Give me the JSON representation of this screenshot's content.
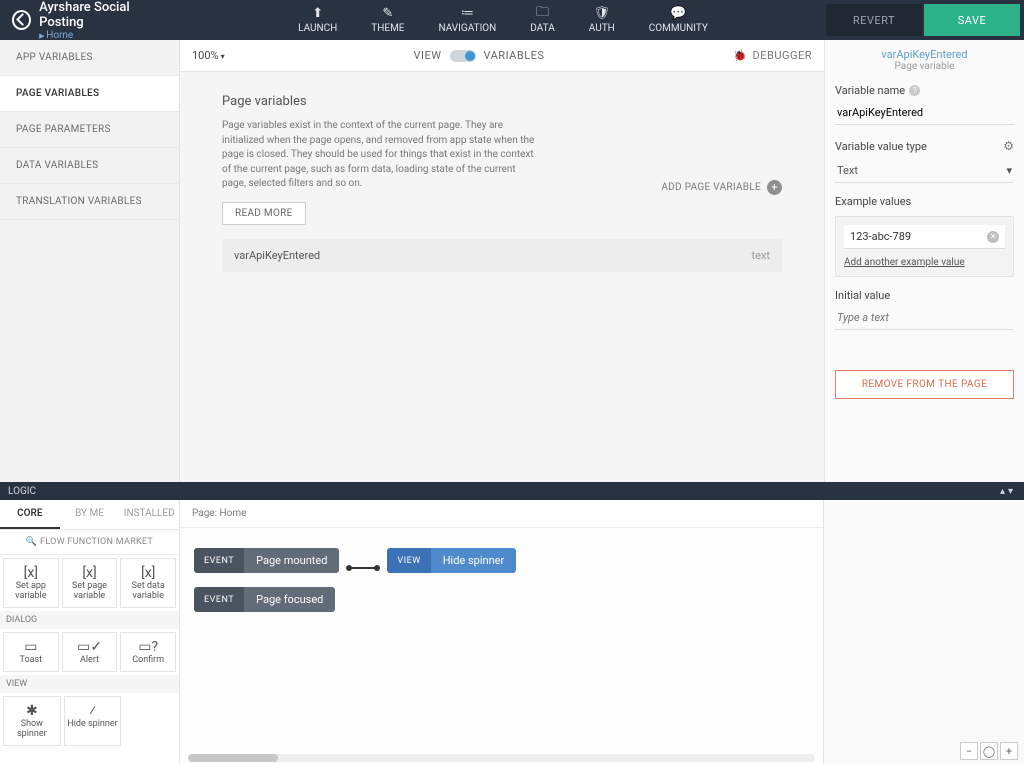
{
  "header": {
    "app_title": "Ayrshare Social Posting",
    "breadcrumb": "Home",
    "nav": [
      {
        "label": "LAUNCH",
        "icon": "⬆"
      },
      {
        "label": "THEME",
        "icon": "✎"
      },
      {
        "label": "NAVIGATION",
        "icon": "≔"
      },
      {
        "label": "DATA",
        "icon": "🗀"
      },
      {
        "label": "AUTH",
        "icon": "🛡"
      },
      {
        "label": "COMMUNITY",
        "icon": "💬"
      }
    ],
    "revert": "REVERT",
    "save": "SAVE"
  },
  "canvas_toolbar": {
    "zoom": "100%",
    "view": "VIEW",
    "variables": "VARIABLES",
    "debugger": "DEBUGGER"
  },
  "leftnav": [
    "APP VARIABLES",
    "PAGE VARIABLES",
    "PAGE PARAMETERS",
    "DATA VARIABLES",
    "TRANSLATION VARIABLES"
  ],
  "leftnav_active": 1,
  "page_variables": {
    "title": "Page variables",
    "desc": "Page variables exist in the context of the current page. They are initialized when the page opens, and removed from app state when the page is closed. They should be used for things that exist in the context of the current page, such as form data, loading state of the current page, selected filters and so on.",
    "read_more": "READ MORE",
    "add": "ADD PAGE VARIABLE",
    "rows": [
      {
        "name": "varApiKeyEntered",
        "type": "text"
      }
    ]
  },
  "right_panel": {
    "crumb": "varApiKeyEntered",
    "sub": "Page variable",
    "name_label": "Variable name",
    "name_value": "varApiKeyEntered",
    "type_label": "Variable value type",
    "type_value": "Text",
    "examples_label": "Example values",
    "examples": [
      "123-abc-789"
    ],
    "add_example": "Add another example value",
    "initial_label": "Initial value",
    "initial_placeholder": "Type a text",
    "remove": "REMOVE FROM THE PAGE"
  },
  "logic": {
    "bar": "LOGIC",
    "tabs": [
      "CORE",
      "BY ME",
      "INSTALLED"
    ],
    "tabs_active": 0,
    "ffm": "FLOW FUNCTION MARKET",
    "groups": [
      {
        "cat": "",
        "tiles": [
          {
            "label": "Set app variable",
            "icon": "[x]"
          },
          {
            "label": "Set page variable",
            "icon": "[x]"
          },
          {
            "label": "Set data variable",
            "icon": "[x]"
          }
        ]
      },
      {
        "cat": "DIALOG",
        "tiles": [
          {
            "label": "Toast",
            "icon": "▭"
          },
          {
            "label": "Alert",
            "icon": "▭✓"
          },
          {
            "label": "Confirm",
            "icon": "▭?"
          }
        ]
      },
      {
        "cat": "VIEW",
        "tiles": [
          {
            "label": "Show spinner",
            "icon": "✱"
          },
          {
            "label": "Hide spinner",
            "icon": "⁄"
          }
        ]
      }
    ],
    "page_crumb": "Page: Home",
    "flow": [
      [
        {
          "kind": "event",
          "tag": "EVENT",
          "body": "Page mounted"
        },
        {
          "kind": "view",
          "tag": "VIEW",
          "body": "Hide spinner"
        }
      ],
      [
        {
          "kind": "event",
          "tag": "EVENT",
          "body": "Page focused"
        }
      ]
    ],
    "zoom_controls": [
      "−",
      "◯",
      "+"
    ]
  }
}
